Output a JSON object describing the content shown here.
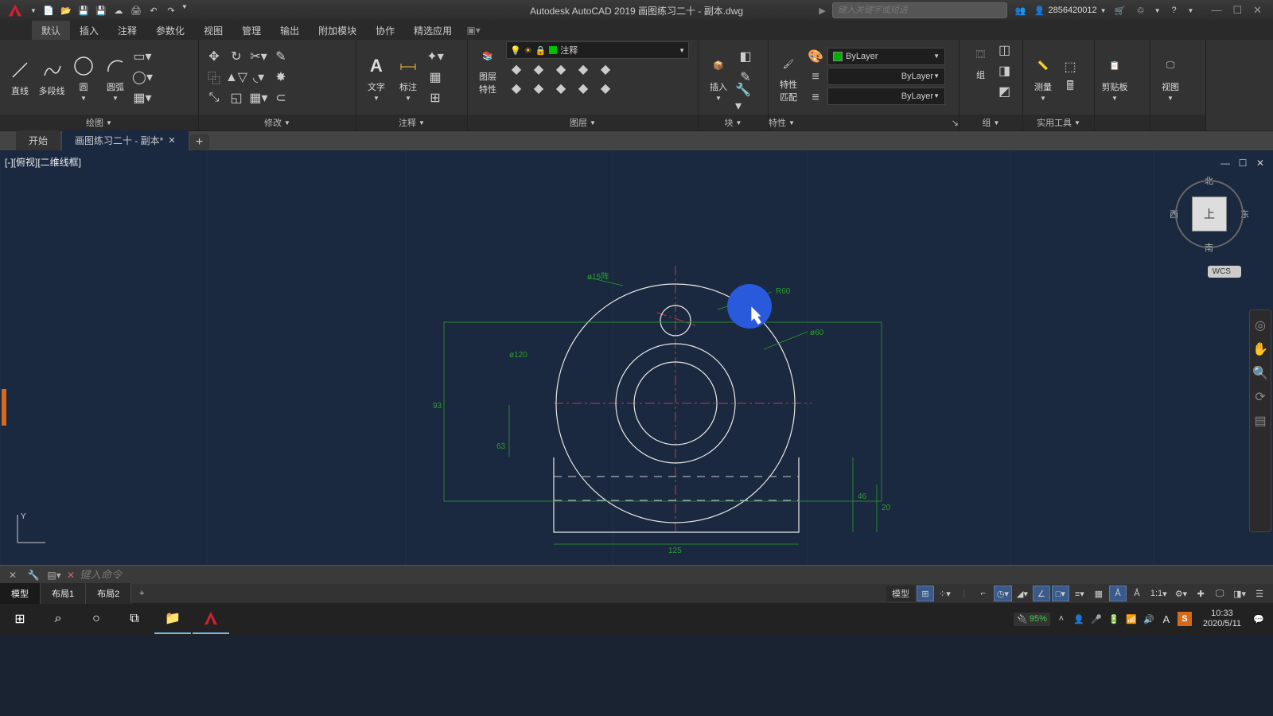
{
  "title": "Autodesk AutoCAD 2019   画图练习二十 - 副本.dwg",
  "search_placeholder": "键入关键字或短语",
  "user_id": "2856420012",
  "menu": [
    "默认",
    "插入",
    "注释",
    "参数化",
    "视图",
    "管理",
    "输出",
    "附加模块",
    "协作",
    "精选应用"
  ],
  "ribbon": {
    "panels": {
      "draw": {
        "title": "绘图",
        "tools": {
          "line": "直线",
          "polyline": "多段线",
          "circle": "圆",
          "arc": "圆弧"
        }
      },
      "modify": {
        "title": "修改"
      },
      "annotation": {
        "title": "注释",
        "tools": {
          "text": "文字",
          "dim": "标注"
        }
      },
      "layers": {
        "title": "图层",
        "props": "图层\n特性",
        "current": "注释"
      },
      "block": {
        "title": "块",
        "insert": "插入"
      },
      "properties": {
        "title": "特性",
        "match": "特性\n匹配",
        "bylayer": "ByLayer"
      },
      "group": {
        "title": "组",
        "group": "组"
      },
      "utilities": {
        "title": "实用工具",
        "measure": "测量"
      },
      "clipboard": {
        "title": "剪贴板",
        "clip": "剪贴板"
      },
      "view": {
        "title": "视图",
        "view": "视图"
      }
    }
  },
  "tabs": {
    "start": "开始",
    "file": "画图练习二十 - 副本*"
  },
  "viewport_label": "[-][俯视][二维线框]",
  "viewcube": {
    "top": "上",
    "n": "北",
    "s": "南",
    "e": "东",
    "w": "西",
    "wcs": "WCS"
  },
  "dimensions": {
    "d1": "ø15阵",
    "d2": "R60",
    "d3": "ø60",
    "d4": "ø120",
    "d5": "93",
    "d6": "125",
    "d7": "63",
    "d8": "46",
    "d9": "20"
  },
  "cmdline_placeholder": "键入命令",
  "layout_tabs": [
    "模型",
    "布局1",
    "布局2"
  ],
  "status": {
    "model": "模型",
    "scale": "1:1"
  },
  "taskbar": {
    "time": "10:33",
    "date": "2020/5/11",
    "battery": "95%"
  }
}
